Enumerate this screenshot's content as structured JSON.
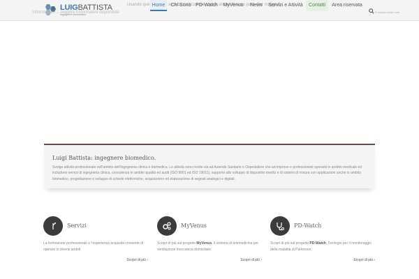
{
  "header": {
    "logo_first": "LUIG",
    "logo_second": "BATTISTA",
    "logo_tagline": "ingegnere biomedico",
    "nav": [
      {
        "label": "Home"
      },
      {
        "label": "Chi Sono"
      },
      {
        "label": "PD-Watch"
      },
      {
        "label": "MyVenus"
      },
      {
        "label": "News"
      },
      {
        "label": "Servizi e Attività"
      },
      {
        "label": "Contatti"
      },
      {
        "label": "Area riservata"
      }
    ],
    "search_icon": "search-icon"
  },
  "cookie": {
    "text": "Usando questo sito si accetta l'utilizzo dei cookie anche di terze parti. Per maggiori",
    "overlay_text": "Informazioni ... leggere l'informativa disponibile",
    "right_text": "© cookie-script.com"
  },
  "intro": {
    "title": "Luigi Battista: ingegnere biomedico.",
    "text": "Svolge attività professionale nell'ambito dell'ingegneria clinica e biomedica. Le attività sono rivolte sia ad Aziende Sanitarie e Ospedaliere che ad imprese e professionisti operanti in ambito medicale ed includono servizi di ingegneria clinica, consulenza in ambito qualità ed audit (ISO 9001 ed ISO 19011), supporto allo sviluppo di dispositivi medici e di sistemi di misura con applicazioni anche in ambito biomedico, progettazione e sviluppo di schede elettroniche, acquisizione ed elaborazione di segnali analogici e digitali."
  },
  "services": [
    {
      "title": "Servizi",
      "icon": "fork-icon",
      "text_before": "La formazione professionale e l'esperienza acquisita consente di operare in diversi ambiti",
      "text_bold": "",
      "text_after": "",
      "more": "Scopri di più ›"
    },
    {
      "title": "MyVenus",
      "icon": "gears-icon",
      "text_before": "Scopri di più sul progetto ",
      "text_bold": "MyVenus",
      "text_after": ", il sistema di telemedicina per ventilazione meccanica domiciliare",
      "more": "Scopri di più ›"
    },
    {
      "title": "PD-Watch",
      "icon": "stethoscope-icon",
      "text_before": "Scopri di più sul progetto ",
      "text_bold": "PD-Watch",
      "text_after": ", l'orologio per il monitoraggio della malattia di Parkinson",
      "more": "Scopri di più ›"
    }
  ],
  "colors": {
    "accent": "#3a78b5",
    "panel_border": "#6b4b4b",
    "icon_bg": "#3b3b3b"
  }
}
